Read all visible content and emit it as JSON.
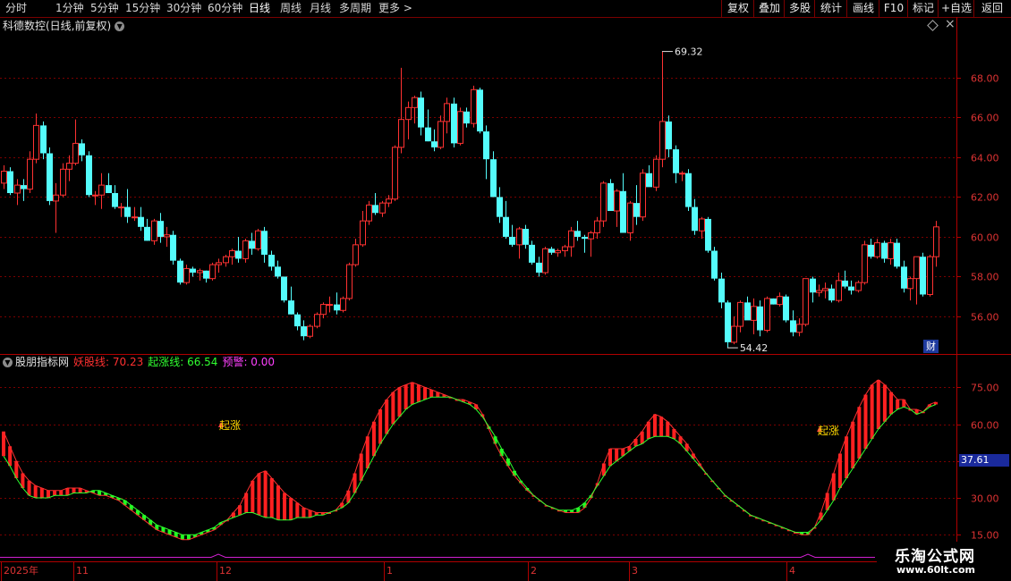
{
  "toolbar": {
    "periods": [
      "分时",
      "1分钟",
      "5分钟",
      "15分钟",
      "30分钟",
      "60分钟",
      "日线",
      "周线",
      "月线",
      "多周期",
      "更多 >"
    ],
    "buttons": [
      "复权",
      "叠加",
      "多股",
      "统计",
      "画线",
      "F10",
      "标记",
      "+自选",
      "返回"
    ]
  },
  "stock": {
    "title": "科德数控(日线,前复权)"
  },
  "indicator": {
    "name": "股朋指标网",
    "line1_label": "妖股线: 70.23",
    "line2_label": "起涨线: 66.54",
    "warn_label": "预警: 0.00",
    "signal_text": "起涨",
    "current_value": "37.61"
  },
  "colors": {
    "up": "#ff3232",
    "down": "#54fcfc",
    "ind_up": "#ff2020",
    "ind_down": "#20ff20",
    "grid": "#7a0000"
  },
  "chart_data": [
    {
      "type": "candlestick",
      "title": "科德数控(日线,前复权)",
      "ylim": [
        54.2,
        70.2
      ],
      "y_ticks": [
        "68.00",
        "66.00",
        "64.00",
        "62.00",
        "60.00",
        "58.00",
        "56.00"
      ],
      "annotations": [
        {
          "text": "69.32",
          "value": 69.32
        },
        {
          "text": "54.42",
          "value": 54.42
        }
      ],
      "ohlc": [
        [
          62.7,
          63.6,
          62.4,
          63.3
        ],
        [
          63.3,
          63.5,
          62.1,
          62.2
        ],
        [
          62.2,
          62.9,
          61.6,
          62.6
        ],
        [
          62.6,
          62.9,
          61.8,
          62.4
        ],
        [
          62.4,
          64.3,
          62.2,
          63.9
        ],
        [
          63.9,
          66.2,
          63.7,
          65.6
        ],
        [
          65.6,
          65.8,
          63.9,
          64.2
        ],
        [
          64.2,
          64.5,
          61.6,
          61.8
        ],
        [
          61.8,
          62.7,
          60.2,
          62.1
        ],
        [
          62.1,
          63.7,
          62.0,
          63.4
        ],
        [
          63.4,
          64.1,
          62.8,
          63.7
        ],
        [
          63.7,
          65.9,
          63.6,
          64.7
        ],
        [
          64.7,
          64.9,
          63.8,
          64.1
        ],
        [
          64.1,
          64.3,
          62.0,
          62.1
        ],
        [
          62.1,
          62.3,
          61.6,
          62.1
        ],
        [
          62.1,
          63.2,
          61.4,
          62.6
        ],
        [
          62.6,
          63.2,
          62.3,
          62.2
        ],
        [
          62.2,
          62.6,
          61.4,
          61.5
        ],
        [
          61.5,
          61.7,
          61.0,
          61.5
        ],
        [
          61.5,
          62.4,
          60.7,
          61.0
        ],
        [
          61.0,
          61.5,
          60.8,
          61.0
        ],
        [
          61.0,
          61.5,
          60.3,
          60.5
        ],
        [
          60.5,
          60.9,
          59.8,
          59.8
        ],
        [
          59.8,
          60.9,
          59.6,
          60.8
        ],
        [
          60.8,
          61.2,
          59.7,
          60.0
        ],
        [
          60.0,
          60.5,
          59.5,
          60.1
        ],
        [
          60.1,
          60.3,
          58.6,
          58.8
        ],
        [
          58.8,
          58.9,
          57.6,
          57.7
        ],
        [
          57.7,
          58.6,
          57.6,
          58.4
        ],
        [
          58.4,
          58.5,
          58.0,
          58.2
        ],
        [
          58.2,
          58.4,
          57.8,
          58.3
        ],
        [
          58.3,
          58.3,
          57.7,
          57.9
        ],
        [
          57.9,
          58.7,
          57.8,
          58.6
        ],
        [
          58.6,
          58.9,
          58.2,
          58.7
        ],
        [
          58.7,
          59.1,
          58.5,
          59.0
        ],
        [
          59.0,
          59.4,
          58.6,
          59.3
        ],
        [
          59.3,
          60.0,
          58.7,
          58.9
        ],
        [
          58.9,
          59.9,
          58.7,
          59.8
        ],
        [
          59.8,
          60.2,
          59.1,
          59.4
        ],
        [
          59.4,
          60.4,
          59.3,
          60.3
        ],
        [
          60.3,
          60.5,
          58.7,
          59.1
        ],
        [
          59.1,
          59.3,
          58.3,
          58.5
        ],
        [
          58.5,
          58.8,
          57.9,
          58.0
        ],
        [
          58.0,
          58.0,
          56.7,
          56.8
        ],
        [
          56.8,
          57.5,
          56.1,
          56.1
        ],
        [
          56.1,
          56.2,
          55.3,
          55.5
        ],
        [
          55.5,
          55.8,
          54.8,
          55.0
        ],
        [
          55.0,
          55.6,
          54.9,
          55.5
        ],
        [
          55.5,
          56.2,
          55.4,
          56.1
        ],
        [
          56.1,
          56.7,
          55.9,
          56.6
        ],
        [
          56.6,
          57.0,
          56.2,
          56.6
        ],
        [
          56.6,
          57.2,
          56.1,
          56.3
        ],
        [
          56.3,
          57.0,
          56.2,
          56.9
        ],
        [
          56.9,
          58.7,
          56.8,
          58.6
        ],
        [
          58.6,
          59.9,
          58.5,
          59.6
        ],
        [
          59.6,
          61.3,
          59.5,
          60.8
        ],
        [
          60.8,
          61.8,
          60.6,
          61.6
        ],
        [
          61.6,
          62.2,
          61.1,
          61.2
        ],
        [
          61.2,
          61.8,
          61.0,
          61.7
        ],
        [
          61.7,
          62.1,
          61.5,
          61.9
        ],
        [
          61.9,
          64.6,
          61.8,
          64.5
        ],
        [
          64.5,
          68.5,
          64.2,
          65.9
        ],
        [
          65.9,
          66.8,
          64.9,
          66.5
        ],
        [
          66.5,
          67.1,
          65.7,
          67.0
        ],
        [
          67.0,
          67.3,
          65.1,
          65.5
        ],
        [
          65.5,
          66.4,
          64.8,
          64.8
        ],
        [
          64.8,
          65.4,
          64.3,
          64.5
        ],
        [
          64.5,
          66.1,
          64.4,
          65.8
        ],
        [
          65.8,
          67.0,
          65.2,
          66.7
        ],
        [
          66.7,
          67.0,
          64.5,
          64.7
        ],
        [
          64.7,
          66.5,
          64.6,
          66.3
        ],
        [
          66.3,
          66.5,
          65.5,
          65.7
        ],
        [
          65.7,
          67.6,
          65.5,
          67.4
        ],
        [
          67.4,
          67.5,
          65.2,
          65.3
        ],
        [
          65.3,
          65.6,
          62.9,
          63.9
        ],
        [
          63.9,
          64.3,
          62.0,
          62.0
        ],
        [
          62.0,
          62.5,
          60.7,
          61.0
        ],
        [
          61.0,
          61.8,
          59.9,
          60.0
        ],
        [
          60.0,
          60.6,
          59.5,
          59.6
        ],
        [
          59.6,
          60.5,
          58.9,
          60.4
        ],
        [
          60.4,
          60.6,
          59.4,
          59.6
        ],
        [
          59.6,
          59.8,
          58.6,
          58.7
        ],
        [
          58.7,
          59.0,
          58.0,
          58.2
        ],
        [
          58.2,
          59.5,
          58.1,
          59.4
        ],
        [
          59.4,
          59.5,
          59.1,
          59.2
        ],
        [
          59.2,
          59.4,
          59.0,
          59.3
        ],
        [
          59.3,
          59.6,
          59.0,
          59.5
        ],
        [
          59.5,
          60.5,
          59.0,
          60.3
        ],
        [
          60.3,
          60.8,
          59.8,
          60.0
        ],
        [
          60.0,
          60.1,
          59.2,
          59.9
        ],
        [
          59.9,
          60.3,
          59.0,
          60.2
        ],
        [
          60.2,
          61.0,
          59.9,
          60.8
        ],
        [
          60.8,
          62.8,
          60.5,
          62.7
        ],
        [
          62.7,
          62.9,
          61.3,
          61.3
        ],
        [
          61.3,
          62.4,
          60.5,
          62.3
        ],
        [
          62.3,
          63.2,
          61.8,
          60.2
        ],
        [
          60.2,
          61.8,
          59.8,
          61.7
        ],
        [
          61.7,
          62.6,
          60.6,
          61.0
        ],
        [
          61.0,
          63.4,
          60.8,
          63.2
        ],
        [
          63.2,
          63.6,
          62.7,
          62.5
        ],
        [
          62.5,
          64.1,
          62.3,
          63.9
        ],
        [
          63.9,
          69.32,
          63.5,
          65.8
        ],
        [
          65.8,
          66.1,
          64.0,
          64.4
        ],
        [
          64.4,
          64.6,
          62.7,
          63.2
        ],
        [
          63.2,
          63.3,
          62.8,
          63.2
        ],
        [
          63.2,
          63.4,
          61.3,
          61.5
        ],
        [
          61.5,
          61.9,
          60.1,
          60.3
        ],
        [
          60.3,
          61.0,
          59.9,
          60.9
        ],
        [
          60.9,
          61.0,
          59.2,
          59.3
        ],
        [
          59.3,
          59.5,
          57.8,
          57.9
        ],
        [
          57.9,
          58.2,
          56.4,
          56.7
        ],
        [
          56.7,
          56.8,
          54.42,
          54.7
        ],
        [
          54.7,
          56.0,
          54.6,
          55.5
        ],
        [
          55.5,
          56.8,
          55.2,
          56.7
        ],
        [
          56.7,
          57.0,
          56.1,
          55.8
        ],
        [
          55.8,
          56.9,
          55.1,
          56.5
        ],
        [
          56.5,
          56.8,
          55.0,
          55.3
        ],
        [
          55.3,
          57.0,
          55.2,
          56.9
        ],
        [
          56.9,
          56.9,
          56.6,
          56.6
        ],
        [
          56.6,
          57.2,
          56.5,
          57.0
        ],
        [
          57.0,
          57.1,
          55.7,
          55.8
        ],
        [
          55.8,
          56.3,
          55.0,
          55.2
        ],
        [
          55.2,
          55.9,
          55.0,
          55.6
        ],
        [
          55.6,
          57.9,
          55.5,
          57.9
        ],
        [
          57.9,
          58.0,
          56.7,
          57.2
        ],
        [
          57.2,
          57.6,
          57.0,
          57.3
        ],
        [
          57.3,
          57.7,
          56.9,
          57.4
        ],
        [
          57.4,
          57.6,
          56.7,
          56.8
        ],
        [
          56.8,
          58.2,
          56.7,
          57.8
        ],
        [
          57.8,
          58.3,
          57.4,
          57.5
        ],
        [
          57.5,
          57.8,
          57.1,
          57.3
        ],
        [
          57.3,
          57.8,
          57.2,
          57.7
        ],
        [
          57.7,
          59.8,
          57.6,
          59.6
        ],
        [
          59.6,
          59.9,
          58.9,
          59.0
        ],
        [
          59.0,
          59.9,
          58.9,
          59.7
        ],
        [
          59.7,
          59.8,
          58.7,
          58.9
        ],
        [
          58.9,
          59.9,
          58.6,
          59.7
        ],
        [
          59.7,
          59.9,
          58.4,
          58.5
        ],
        [
          58.5,
          58.8,
          57.2,
          57.4
        ],
        [
          57.4,
          58.0,
          56.8,
          57.9
        ],
        [
          57.9,
          59.0,
          56.6,
          59.0
        ],
        [
          59.0,
          59.2,
          57.0,
          57.1
        ],
        [
          57.1,
          59.1,
          57.0,
          59.0
        ],
        [
          59.0,
          60.8,
          58.5,
          60.5
        ]
      ]
    },
    {
      "type": "line",
      "title": "股朋指标网",
      "ylim": [
        10,
        82
      ],
      "y_ticks": [
        "75.00",
        "60.00",
        "45.00",
        "30.00",
        "15.00"
      ],
      "x_tick_labels": [
        "2025年",
        "11",
        "12",
        "1",
        "2",
        "3",
        "4"
      ],
      "signal_text": "起涨",
      "series": [
        {
          "name": "妖股线",
          "color": "#ff2020",
          "values": [
            57,
            51,
            45,
            40,
            37,
            35,
            34,
            33,
            33,
            33,
            34,
            34,
            34,
            33,
            32,
            31,
            31,
            30,
            29,
            27,
            25,
            23,
            21,
            19,
            17,
            16,
            15,
            14,
            13,
            13,
            14,
            15,
            16,
            17,
            19,
            21,
            24,
            27,
            32,
            37,
            40,
            41,
            38,
            35,
            32,
            30,
            28,
            26,
            25,
            24,
            24,
            24,
            25,
            28,
            33,
            40,
            48,
            55,
            61,
            66,
            70,
            73,
            75,
            76,
            77,
            76,
            75,
            74,
            73,
            72,
            71,
            70,
            70,
            69,
            68,
            64,
            58,
            52,
            47,
            43,
            39,
            36,
            33,
            31,
            29,
            27,
            26,
            25,
            24,
            24,
            24,
            26,
            30,
            36,
            44,
            50,
            50,
            50,
            51,
            54,
            57,
            61,
            64,
            63,
            61,
            58,
            55,
            52,
            48,
            44,
            40,
            37,
            34,
            31,
            29,
            27,
            25,
            23,
            22,
            21,
            20,
            19,
            18,
            17,
            16,
            15,
            15,
            18,
            24,
            32,
            40,
            48,
            55,
            61,
            67,
            72,
            76,
            78,
            76,
            73,
            70,
            70,
            66,
            66,
            65,
            68,
            69
          ]
        },
        {
          "name": "起涨线",
          "color": "#20ff20",
          "values": [
            47,
            43,
            38,
            34,
            31,
            30,
            30,
            30,
            31,
            31,
            31,
            32,
            32,
            32,
            33,
            33,
            32,
            31,
            30,
            29,
            27,
            25,
            23,
            21,
            19,
            18,
            17,
            16,
            15,
            15,
            15,
            16,
            17,
            18,
            20,
            21,
            22,
            23,
            24,
            24,
            23,
            22,
            22,
            21,
            21,
            21,
            22,
            22,
            22,
            23,
            23,
            24,
            25,
            26,
            28,
            32,
            37,
            42,
            47,
            52,
            56,
            60,
            63,
            66,
            68,
            69,
            70,
            71,
            71,
            71,
            71,
            70,
            69,
            68,
            66,
            63,
            59,
            55,
            50,
            46,
            41,
            37,
            34,
            31,
            29,
            27,
            26,
            25,
            25,
            25,
            26,
            28,
            31,
            35,
            39,
            43,
            45,
            47,
            49,
            51,
            52,
            54,
            55,
            55,
            55,
            54,
            52,
            49,
            46,
            43,
            40,
            37,
            34,
            31,
            29,
            27,
            25,
            23,
            22,
            21,
            20,
            19,
            18,
            17,
            16,
            16,
            16,
            18,
            21,
            25,
            29,
            34,
            38,
            42,
            46,
            50,
            54,
            58,
            61,
            64,
            66,
            67,
            66,
            64,
            65,
            67,
            68
          ]
        },
        {
          "name": "预警",
          "color": "#d020d0",
          "values": [
            0
          ]
        }
      ]
    }
  ]
}
